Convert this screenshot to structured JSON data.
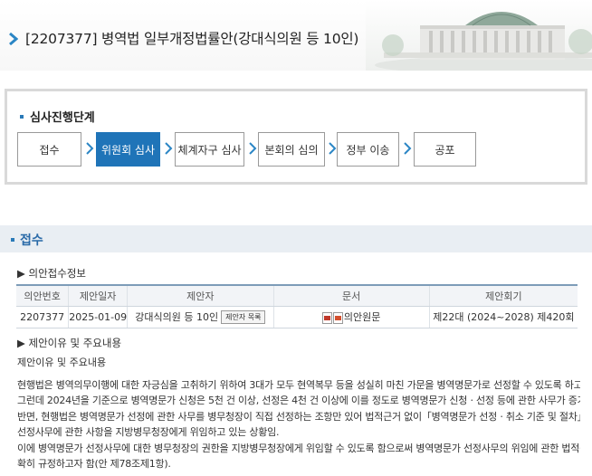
{
  "header": {
    "title": "[2207377] 병역법 일부개정법률안(강대식의원 등 10인)"
  },
  "stages": {
    "label": "심사진행단계",
    "steps": [
      {
        "label": "접수",
        "active": false
      },
      {
        "label": "위원회 심사",
        "active": true
      },
      {
        "label": "체계자구 심사",
        "active": false
      },
      {
        "label": "본회의 심의",
        "active": false
      },
      {
        "label": "정부 이송",
        "active": false
      },
      {
        "label": "공포",
        "active": false
      }
    ]
  },
  "section": {
    "title": "접수"
  },
  "receipt": {
    "heading": "▶ 의안접수정보",
    "columns": [
      "의안번호",
      "제안일자",
      "제안자",
      "문서",
      "제안회기"
    ],
    "row": {
      "bill_no": "2207377",
      "date": "2025-01-09",
      "proposer": "강대식의원 등 10인",
      "proposer_button": "제안자 목록",
      "document": "의안원문",
      "session": "제22대 (2024~2028) 제420회"
    }
  },
  "reason": {
    "heading": "▶ 제안이유 및 주요내용",
    "subheading": "제안이유 및 주요내용",
    "lines": [
      "현행법은 병역의무이행에 대한 자긍심을 고취하기 위하여 3대가 모두 현역복무 등을 성실히 마친 가문을 병역명문가로 선정할 수 있도록 하고 있음.",
      "그런데 2024년을 기준으로 병역명문가 신청은 5천 건 이상, 선정은 4천 건 이상에 이를 정도로 병역명문가 신청ㆍ선정 등에 관한 사무가 증가하고 있는",
      "반면, 현행법은 병역명문가 선정에 관한 사무를 병무청장이 직접 선정하는 조항만 있어 법적근거 없이「병역명문가 선정ㆍ취소 기준 및 절차」고시를 통해",
      "선정사무에 관한 사항을 지방병무청장에게 위임하고 있는 상황임.",
      "이에 병역명문가 선정사무에 대한 병무청장의 권한을 지방병무청장에게 위임할 수 있도록 함으로써 병역명문가 선정사무의 위임에 관한 법적근거를 명",
      "확히 규정하고자 함(안 제78조제1항)."
    ]
  },
  "colors": {
    "accent": "#1f74b8",
    "section_bg": "#e9eef3",
    "section_text": "#2a6aa8"
  },
  "icons": [
    "chevron-right-icon",
    "assembly-building-image",
    "pdf-icon",
    "hwp-icon",
    "arrow-right-icon"
  ]
}
